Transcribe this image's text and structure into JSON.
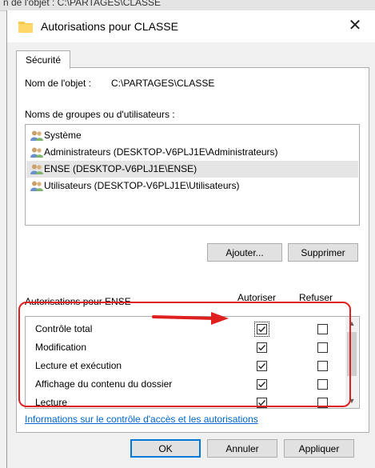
{
  "background": {
    "partial_text": "n de l'objet : C:\\PARTAGES\\CLASSE"
  },
  "window": {
    "title": "Autorisations pour CLASSE",
    "close_glyph": "✕"
  },
  "tabs": [
    {
      "label": "Sécurité",
      "active": true
    }
  ],
  "object": {
    "label": "Nom de l'objet :",
    "value": "C:\\PARTAGES\\CLASSE"
  },
  "groups": {
    "label": "Noms de groupes ou d'utilisateurs :",
    "items": [
      {
        "name": "Système",
        "icon": "users-icon",
        "selected": false
      },
      {
        "name": "Administrateurs (DESKTOP-V6PLJ1E\\Administrateurs)",
        "icon": "users-icon",
        "selected": false
      },
      {
        "name": "ENSE (DESKTOP-V6PLJ1E\\ENSE)",
        "icon": "users-icon",
        "selected": true
      },
      {
        "name": "Utilisateurs (DESKTOP-V6PLJ1E\\Utilisateurs)",
        "icon": "users-icon",
        "selected": false
      }
    ]
  },
  "buttons": {
    "add": "Ajouter...",
    "remove": "Supprimer",
    "ok": "OK",
    "cancel": "Annuler",
    "apply": "Appliquer"
  },
  "permissions": {
    "label": "Autorisations pour ENSE",
    "allow_header": "Autoriser",
    "deny_header": "Refuser",
    "rows": [
      {
        "name": "Contrôle total",
        "allow": true,
        "deny": false
      },
      {
        "name": "Modification",
        "allow": true,
        "deny": false
      },
      {
        "name": "Lecture et exécution",
        "allow": true,
        "deny": false
      },
      {
        "name": "Affichage du contenu du dossier",
        "allow": true,
        "deny": false
      },
      {
        "name": "Lecture",
        "allow": true,
        "deny": false
      }
    ]
  },
  "help_link": "Informations sur le contrôle d'accès et les autorisations",
  "colors": {
    "accent": "#0078d7",
    "link": "#0066cc",
    "annotation": "#e02020",
    "selection": "#e5e5e5"
  }
}
